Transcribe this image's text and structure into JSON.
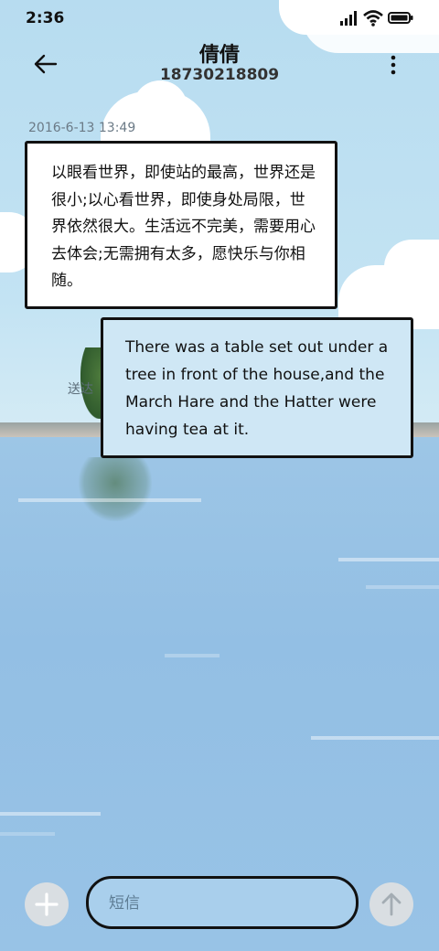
{
  "status_bar": {
    "time": "2:36",
    "signal_icon": "signal-icon",
    "wifi_icon": "wifi-icon",
    "battery_icon": "battery-icon"
  },
  "header": {
    "back_icon": "back-arrow-icon",
    "contact_name": "倩倩",
    "phone_number": "18730218809",
    "more_icon": "more-vertical-icon"
  },
  "conversation": {
    "timestamp": "2016-6-13 13:49",
    "messages": [
      {
        "direction": "incoming",
        "text": "以眼看世界，即使站的最高，世界还是很小;以心看世界，即使身处局限，世界依然很大。生活远不完美，需要用心去体会;无需拥有太多，愿快乐与你相随。"
      },
      {
        "direction": "outgoing",
        "text": "There was a table set out under a tree in front of the house,and the March Hare and the Hatter were having tea at it.",
        "status": "送达"
      }
    ]
  },
  "composer": {
    "add_icon": "plus-icon",
    "placeholder": "短信",
    "value": "",
    "send_icon": "send-arrow-icon"
  },
  "colors": {
    "sky": "#b7dcf0",
    "water": "#98c3e6",
    "incoming_bubble": "#ffffff",
    "outgoing_bubble": "#cfe7f5",
    "button_bg": "#d9dee2"
  }
}
